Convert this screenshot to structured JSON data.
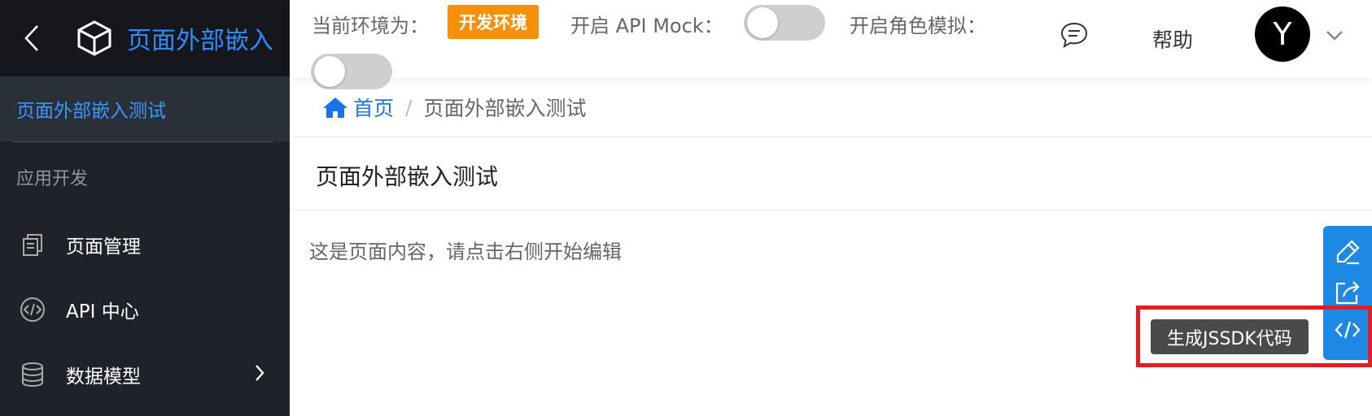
{
  "sidebar": {
    "title": "页面外部嵌入",
    "active_item": "页面外部嵌入测试",
    "group_label": "应用开发",
    "items": [
      {
        "label": "页面管理",
        "icon": "document-copy-icon"
      },
      {
        "label": "API 中心",
        "icon": "code-circle-icon"
      },
      {
        "label": "数据模型",
        "icon": "database-icon"
      }
    ]
  },
  "topbar": {
    "env_label": "当前环境为：",
    "env_badge": "开发环境",
    "mock_label": "开启 API Mock：",
    "role_label": "开启角色模拟：",
    "help": "帮助",
    "avatar_initial": "Y"
  },
  "breadcrumb": {
    "home": "首页",
    "separator": "/",
    "current": "页面外部嵌入测试"
  },
  "page": {
    "title": "页面外部嵌入测试",
    "body": "这是页面内容，请点击右侧开始编辑"
  },
  "tools": {
    "tooltip": "生成JSSDK代码",
    "buttons": [
      "edit-icon",
      "share-icon",
      "code-icon"
    ]
  },
  "colors": {
    "sidebar_bg": "#1f2329",
    "accent": "#2f8cff",
    "env_badge": "#f5900a",
    "tools_bg": "#1e88e5",
    "highlight": "#e51c23"
  }
}
